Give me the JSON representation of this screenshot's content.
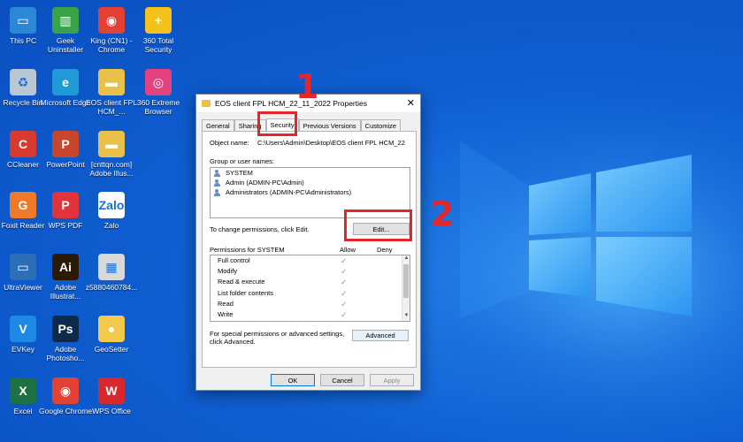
{
  "desktop": {
    "icons": [
      {
        "label": "This PC",
        "icon": "monitor-icon",
        "color": "#2b88d8"
      },
      {
        "label": "Geek Uninstaller",
        "icon": "trash-icon",
        "color": "#3aa34a"
      },
      {
        "label": "King (CN1) - Chrome",
        "icon": "chrome-icon",
        "color": "#e34133"
      },
      {
        "label": "360 Total Security",
        "icon": "plus-shield-icon",
        "color": "#f4c21b"
      },
      {
        "label": "Recycle Bin",
        "icon": "recycle-bin-icon",
        "color": "#b9c6d4"
      },
      {
        "label": "Microsoft Edge",
        "icon": "edge-icon",
        "color": "#1f9ad6"
      },
      {
        "label": "EOS client FPL HCM_...",
        "icon": "folder-icon",
        "color": "#e8c04a"
      },
      {
        "label": "360 Extreme Browser",
        "icon": "browser-icon",
        "color": "#e2427d"
      },
      {
        "label": "CCleaner",
        "icon": "ccleaner-icon",
        "color": "#d83a2e"
      },
      {
        "label": "PowerPoint",
        "icon": "powerpoint-icon",
        "color": "#c8462c"
      },
      {
        "label": "[cnttqn.com] Adobe Illus...",
        "icon": "folder-icon",
        "color": "#e8c04a"
      },
      {
        "label": "Foxit Reader",
        "icon": "foxit-icon",
        "color": "#f0792a"
      },
      {
        "label": "WPS PDF",
        "icon": "pdf-icon",
        "color": "#e0333c"
      },
      {
        "label": "Zalo",
        "icon": "zalo-icon",
        "color": "#ffffff"
      },
      {
        "label": "UltraViewer",
        "icon": "ultraviewer-icon",
        "color": "#2c6fb7"
      },
      {
        "label": "Adobe Illustrat...",
        "icon": "illustrator-icon",
        "color": "#2b1a05"
      },
      {
        "label": "z5880460784...",
        "icon": "image-file-icon",
        "color": "#d9d9d9"
      },
      {
        "label": "EVKey",
        "icon": "evkey-icon",
        "color": "#1e88e5"
      },
      {
        "label": "Adobe Photosho...",
        "icon": "photoshop-icon",
        "color": "#0e2a4a"
      },
      {
        "label": "GeoSetter",
        "icon": "geosetter-icon",
        "color": "#f2c94c"
      },
      {
        "label": "Excel",
        "icon": "excel-icon",
        "color": "#1e7145"
      },
      {
        "label": "Google Chrome",
        "icon": "chrome-icon",
        "color": "#e34133"
      },
      {
        "label": "WPS Office",
        "icon": "wps-office-icon",
        "color": "#d7282d"
      }
    ]
  },
  "dialog": {
    "title": "EOS client FPL HCM_22_11_2022 Properties",
    "close": "✕",
    "tabs": [
      {
        "label": "General"
      },
      {
        "label": "Sharing"
      },
      {
        "label": "Security"
      },
      {
        "label": "Previous Versions"
      },
      {
        "label": "Customize"
      }
    ],
    "object_name_label": "Object name:",
    "object_name_value": "C:\\Users\\Admin\\Desktop\\EOS client FPL HCM_22",
    "groups_label": "Group or user names:",
    "users": [
      {
        "name": "SYSTEM"
      },
      {
        "name": "Admin (ADMIN-PC\\Admin)"
      },
      {
        "name": "Administrators (ADMIN-PC\\Administrators)"
      }
    ],
    "change_perm_text": "To change permissions, click Edit.",
    "edit_button": "Edit...",
    "permissions_label": "Permissions for SYSTEM",
    "allow_header": "Allow",
    "deny_header": "Deny",
    "permissions": [
      {
        "name": "Full control",
        "allow": "✓"
      },
      {
        "name": "Modify",
        "allow": "✓"
      },
      {
        "name": "Read & execute",
        "allow": "✓"
      },
      {
        "name": "List folder contents",
        "allow": "✓"
      },
      {
        "name": "Read",
        "allow": "✓"
      },
      {
        "name": "Write",
        "allow": "✓"
      }
    ],
    "special_text_1": "For special permissions or advanced settings,",
    "special_text_2": "click Advanced.",
    "advanced_button": "Advanced",
    "ok_button": "OK",
    "cancel_button": "Cancel",
    "apply_button": "Apply"
  },
  "annotations": {
    "step1": "1",
    "step2": "2",
    "color": "#e3262a"
  }
}
